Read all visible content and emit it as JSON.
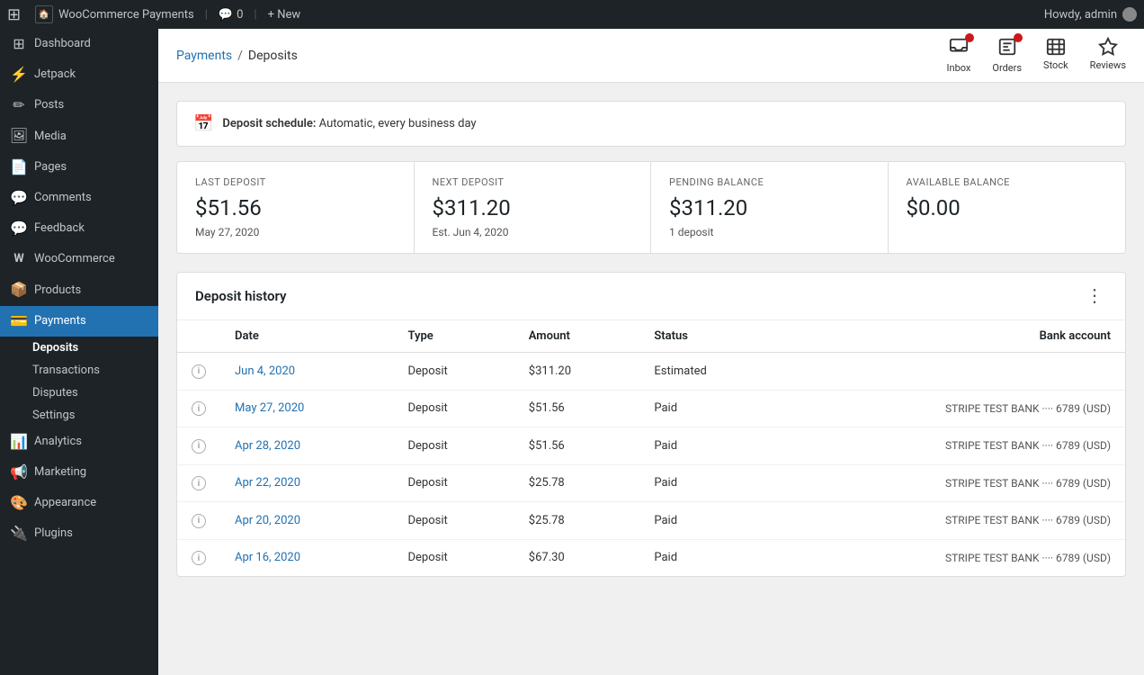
{
  "adminBar": {
    "wpLogo": "W",
    "siteName": "WooCommerce Payments",
    "comments": "0",
    "newLabel": "+ New",
    "howdy": "Howdy, admin"
  },
  "sidebar": {
    "items": [
      {
        "id": "dashboard",
        "label": "Dashboard",
        "icon": "⊞"
      },
      {
        "id": "jetpack",
        "label": "Jetpack",
        "icon": "●"
      },
      {
        "id": "posts",
        "label": "Posts",
        "icon": "✏"
      },
      {
        "id": "media",
        "label": "Media",
        "icon": "🖼"
      },
      {
        "id": "pages",
        "label": "Pages",
        "icon": "📄"
      },
      {
        "id": "comments",
        "label": "Comments",
        "icon": "💬"
      },
      {
        "id": "feedback",
        "label": "Feedback",
        "icon": "💬"
      },
      {
        "id": "woocommerce",
        "label": "WooCommerce",
        "icon": "W"
      },
      {
        "id": "products",
        "label": "Products",
        "icon": "📦"
      },
      {
        "id": "payments",
        "label": "Payments",
        "icon": "💳",
        "active": true
      }
    ],
    "paymentsSubItems": [
      {
        "id": "deposits",
        "label": "Deposits",
        "active": true
      },
      {
        "id": "transactions",
        "label": "Transactions"
      },
      {
        "id": "disputes",
        "label": "Disputes"
      },
      {
        "id": "settings",
        "label": "Settings"
      }
    ],
    "bottomItems": [
      {
        "id": "analytics",
        "label": "Analytics",
        "icon": "📊"
      },
      {
        "id": "marketing",
        "label": "Marketing",
        "icon": "📢"
      },
      {
        "id": "appearance",
        "label": "Appearance",
        "icon": "🎨"
      },
      {
        "id": "plugins",
        "label": "Plugins",
        "icon": "🔌"
      }
    ]
  },
  "toolbar": {
    "breadcrumb": {
      "parent": "Payments",
      "separator": "/",
      "current": "Deposits"
    },
    "icons": [
      {
        "id": "inbox",
        "label": "Inbox",
        "hasBadge": true
      },
      {
        "id": "orders",
        "label": "Orders",
        "hasBadge": true
      },
      {
        "id": "stock",
        "label": "Stock",
        "hasBadge": false
      },
      {
        "id": "reviews",
        "label": "Reviews",
        "hasBadge": false
      }
    ]
  },
  "depositSchedule": {
    "labelBold": "Deposit schedule:",
    "labelText": "Automatic, every business day"
  },
  "summaryCards": [
    {
      "id": "last-deposit",
      "label": "LAST DEPOSIT",
      "amount": "$51.56",
      "sub": "May 27, 2020"
    },
    {
      "id": "next-deposit",
      "label": "NEXT DEPOSIT",
      "amount": "$311.20",
      "sub": "Est. Jun 4, 2020"
    },
    {
      "id": "pending-balance",
      "label": "PENDING BALANCE",
      "amount": "$311.20",
      "sub": "1 deposit"
    },
    {
      "id": "available-balance",
      "label": "AVAILABLE BALANCE",
      "amount": "$0.00",
      "sub": ""
    }
  ],
  "depositHistory": {
    "title": "Deposit history",
    "columns": [
      "Date",
      "Type",
      "Amount",
      "Status",
      "Bank account"
    ],
    "rows": [
      {
        "date": "Jun 4, 2020",
        "type": "Deposit",
        "amount": "$311.20",
        "status": "Estimated",
        "bankAccount": ""
      },
      {
        "date": "May 27, 2020",
        "type": "Deposit",
        "amount": "$51.56",
        "status": "Paid",
        "bankAccount": "STRIPE TEST BANK ···· 6789 (USD)"
      },
      {
        "date": "Apr 28, 2020",
        "type": "Deposit",
        "amount": "$51.56",
        "status": "Paid",
        "bankAccount": "STRIPE TEST BANK ···· 6789 (USD)"
      },
      {
        "date": "Apr 22, 2020",
        "type": "Deposit",
        "amount": "$25.78",
        "status": "Paid",
        "bankAccount": "STRIPE TEST BANK ···· 6789 (USD)"
      },
      {
        "date": "Apr 20, 2020",
        "type": "Deposit",
        "amount": "$25.78",
        "status": "Paid",
        "bankAccount": "STRIPE TEST BANK ···· 6789 (USD)"
      },
      {
        "date": "Apr 16, 2020",
        "type": "Deposit",
        "amount": "$67.30",
        "status": "Paid",
        "bankAccount": "STRIPE TEST BANK ···· 6789 (USD)"
      }
    ]
  }
}
